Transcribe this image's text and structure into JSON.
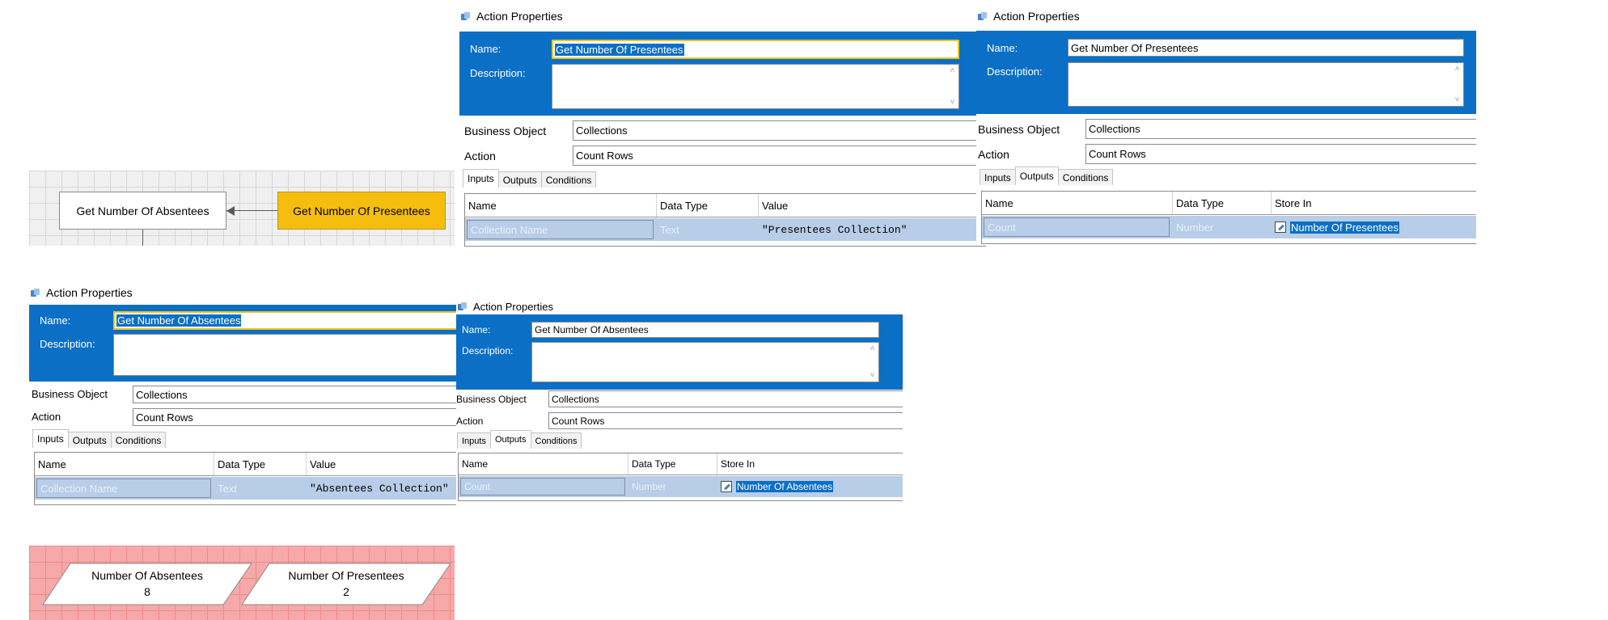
{
  "canvas": {
    "stage_left": "Get Number Of Absentees",
    "stage_right": "Get Number Of Presentees"
  },
  "panel_common": {
    "title": "Action Properties",
    "name_label": "Name:",
    "description_label": "Description:",
    "business_object_label": "Business Object",
    "action_label": "Action",
    "business_object_value": "Collections",
    "action_value": "Count Rows",
    "tabs": [
      "Inputs",
      "Outputs",
      "Conditions"
    ]
  },
  "panel_presentees_inputs": {
    "name_value": "Get Number Of Presentees",
    "active_tab": "Inputs",
    "columns": [
      "Name",
      "Data Type",
      "Value"
    ],
    "row": [
      "Collection Name",
      "Text",
      "\"Presentees Collection\""
    ]
  },
  "panel_presentees_outputs": {
    "name_value": "Get Number Of Presentees",
    "active_tab": "Outputs",
    "columns": [
      "Name",
      "Data Type",
      "Store In"
    ],
    "row": [
      "Count",
      "Number",
      "Number Of Presentees"
    ]
  },
  "panel_absentees_inputs": {
    "name_value": "Get Number Of Absentees",
    "active_tab": "Inputs",
    "columns": [
      "Name",
      "Data Type",
      "Value"
    ],
    "row": [
      "Collection Name",
      "Text",
      "\"Absentees Collection\""
    ]
  },
  "panel_absentees_outputs": {
    "name_value": "Get Number Of Absentees",
    "active_tab": "Outputs",
    "columns": [
      "Name",
      "Data Type",
      "Store In"
    ],
    "row": [
      "Count",
      "Number",
      "Number Of Absentees"
    ]
  },
  "data_items": [
    {
      "name": "Number Of Absentees",
      "value": "8"
    },
    {
      "name": "Number Of Presentees",
      "value": "2"
    }
  ],
  "colors": {
    "header_blue": "#0b6fc6",
    "stage_highlight": "#f5bd0e",
    "row_selected": "#b8cde8",
    "data_canvas": "#f7a8a8"
  },
  "icons": [
    "action-properties-icon",
    "store-in-icon",
    "scroll-up-icon",
    "scroll-down-icon",
    "arrow-head-icon"
  ]
}
